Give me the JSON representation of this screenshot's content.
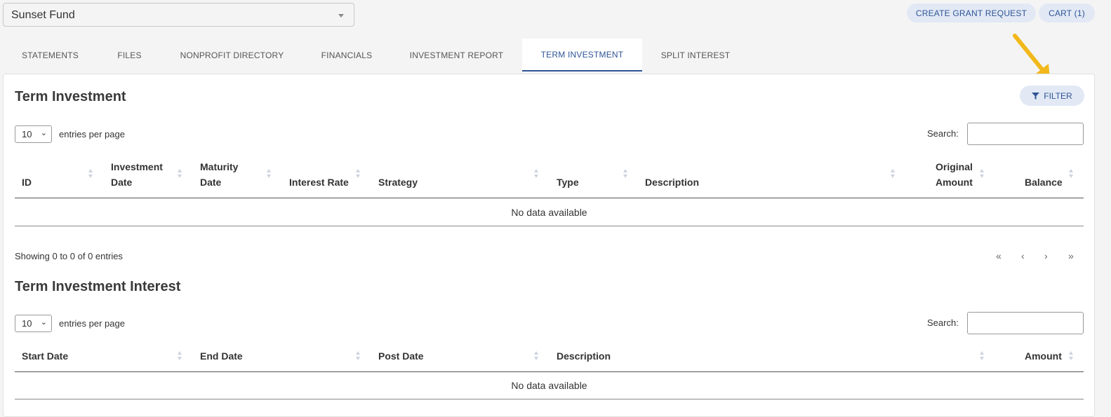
{
  "fund_selector": {
    "value": "Sunset Fund",
    "caret": "caret-down-icon"
  },
  "header_buttons": {
    "create_grant": "CREATE GRANT REQUEST",
    "cart": "CART (1)"
  },
  "tabs": [
    {
      "label": "STATEMENTS"
    },
    {
      "label": "FILES"
    },
    {
      "label": "NONPROFIT DIRECTORY"
    },
    {
      "label": "FINANCIALS"
    },
    {
      "label": "INVESTMENT REPORT"
    },
    {
      "label": "TERM INVESTMENT",
      "active": true
    },
    {
      "label": "SPLIT INTEREST"
    }
  ],
  "filter_button": {
    "label": "FILTER",
    "icon": "filter-icon"
  },
  "accent_color": "#2f5596",
  "arrow_color": "#f2b81b",
  "term_investment": {
    "title": "Term Investment",
    "entries_value": "10",
    "entries_label": "entries per page",
    "search_label": "Search:",
    "columns": [
      {
        "line1": "",
        "line2": "ID"
      },
      {
        "line1": "Investment",
        "line2": "Date"
      },
      {
        "line1": "Maturity",
        "line2": "Date"
      },
      {
        "line1": "",
        "line2": "Interest Rate"
      },
      {
        "line1": "",
        "line2": "Strategy"
      },
      {
        "line1": "",
        "line2": "Type"
      },
      {
        "line1": "",
        "line2": "Description"
      },
      {
        "line1": "Original",
        "line2": "Amount"
      },
      {
        "line1": "",
        "line2": "Balance"
      }
    ],
    "no_data": "No data available",
    "showing": "Showing 0 to 0 of 0 entries",
    "pager": {
      "first": "«",
      "prev": "‹",
      "next": "›",
      "last": "»"
    }
  },
  "term_investment_interest": {
    "title": "Term Investment Interest",
    "entries_value": "10",
    "entries_label": "entries per page",
    "search_label": "Search:",
    "columns": [
      "Start Date",
      "End Date",
      "Post Date",
      "Description",
      "Amount"
    ],
    "no_data": "No data available"
  }
}
